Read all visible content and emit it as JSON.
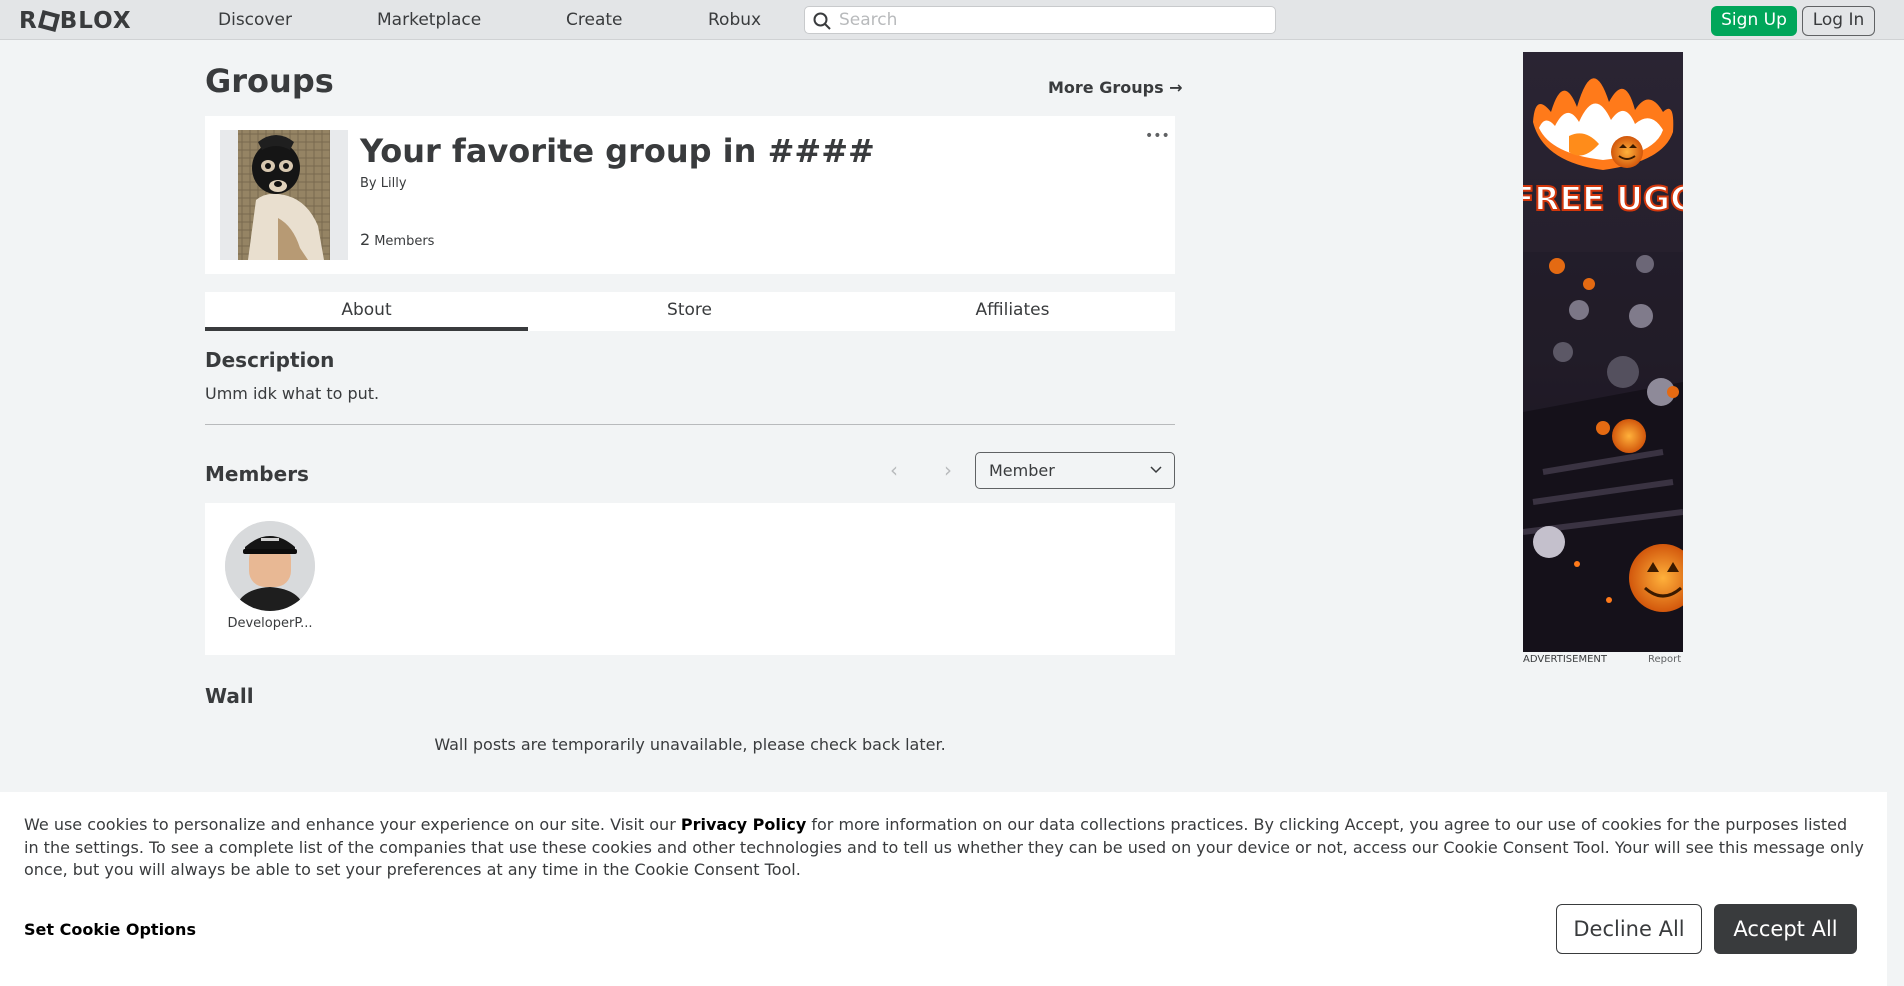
{
  "nav": {
    "logo_left": "R",
    "logo_right": "BLOX",
    "links": [
      "Discover",
      "Marketplace",
      "Create",
      "Robux"
    ],
    "search_placeholder": "Search",
    "signup_label": "Sign Up",
    "login_label": "Log In"
  },
  "page": {
    "title": "Groups",
    "more_groups": "More Groups →"
  },
  "group": {
    "name": "Your favorite group in ####",
    "by_prefix": "By",
    "owner": "Lilly",
    "member_count": "2",
    "member_label": "Members",
    "more_icon": "•••"
  },
  "tabs": [
    {
      "label": "About",
      "active": true
    },
    {
      "label": "Store",
      "active": false
    },
    {
      "label": "Affiliates",
      "active": false
    }
  ],
  "about": {
    "description_title": "Description",
    "description_text": "Umm idk what to put.",
    "members_title": "Members",
    "prev_icon": "‹",
    "next_icon": "›",
    "role_selected": "Member",
    "members": [
      {
        "name": "DeveloperP..."
      }
    ],
    "wall_title": "Wall",
    "wall_message": "Wall posts are temporarily unavailable, please check back later."
  },
  "ad": {
    "banner_text": "FREE UGC",
    "label": "ADVERTISEMENT",
    "report": "Report"
  },
  "cookie": {
    "text_before": "We use cookies to personalize and enhance your experience on our site. Visit our ",
    "policy_link": "Privacy Policy",
    "text_after": " for more information on our data collections practices. By clicking Accept, you agree to our use of cookies for the purposes listed in the settings. To see a complete list of the companies that use these cookies and other technologies and to tell us whether they can be used on your device or not, access our Cookie Consent Tool. Your will see this message only once, but you will always be able to set your preferences at any time in the Cookie Consent Tool.",
    "set_options": "Set Cookie Options",
    "decline": "Decline All",
    "accept": "Accept All"
  }
}
